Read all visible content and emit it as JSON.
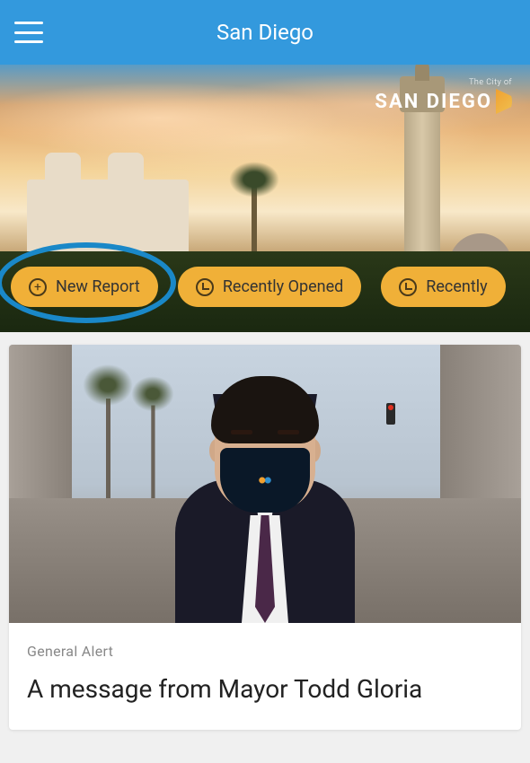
{
  "header": {
    "title": "San Diego"
  },
  "logo": {
    "tagline": "The City of",
    "name": "SAN DIEGO"
  },
  "pills": [
    {
      "icon": "plus",
      "label": "New Report"
    },
    {
      "icon": "clock",
      "label": "Recently Opened"
    },
    {
      "icon": "clock",
      "label": "Recently"
    }
  ],
  "card": {
    "category": "General Alert",
    "title": "A message from Mayor Todd Gloria"
  },
  "colors": {
    "header": "#3399dd",
    "pill": "#f0b038",
    "highlight": "#1a88c8"
  }
}
